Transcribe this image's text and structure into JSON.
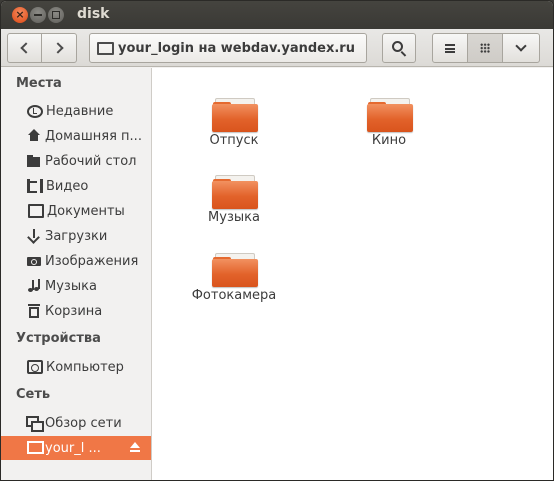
{
  "window": {
    "title": "disk"
  },
  "toolbar": {
    "location": "your_login на webdav.yandex.ru"
  },
  "sidebar": {
    "sections": [
      {
        "title": "Места",
        "items": [
          {
            "label": "Недавние",
            "icon": "clock-icon"
          },
          {
            "label": "Домашняя п...",
            "icon": "home-icon"
          },
          {
            "label": "Рабочий стол",
            "icon": "folder-icon"
          },
          {
            "label": "Видео",
            "icon": "film-icon"
          },
          {
            "label": "Документы",
            "icon": "document-icon"
          },
          {
            "label": "Загрузки",
            "icon": "download-icon"
          },
          {
            "label": "Изображения",
            "icon": "camera-icon"
          },
          {
            "label": "Музыка",
            "icon": "music-icon"
          },
          {
            "label": "Корзина",
            "icon": "trash-icon"
          }
        ]
      },
      {
        "title": "Устройства",
        "items": [
          {
            "label": "Компьютер",
            "icon": "computer-icon"
          }
        ]
      },
      {
        "title": "Сеть",
        "items": [
          {
            "label": "Обзор сети",
            "icon": "network-icon"
          },
          {
            "label": "your_l ...",
            "icon": "network-drive-icon",
            "active": true
          }
        ]
      }
    ]
  },
  "files": [
    {
      "name": "Отпуск"
    },
    {
      "name": "Кино"
    },
    {
      "name": "Музыка"
    },
    {
      "name": "Фотокамера"
    }
  ],
  "colors": {
    "accent": "#f07746",
    "folder": "#e2622a"
  }
}
